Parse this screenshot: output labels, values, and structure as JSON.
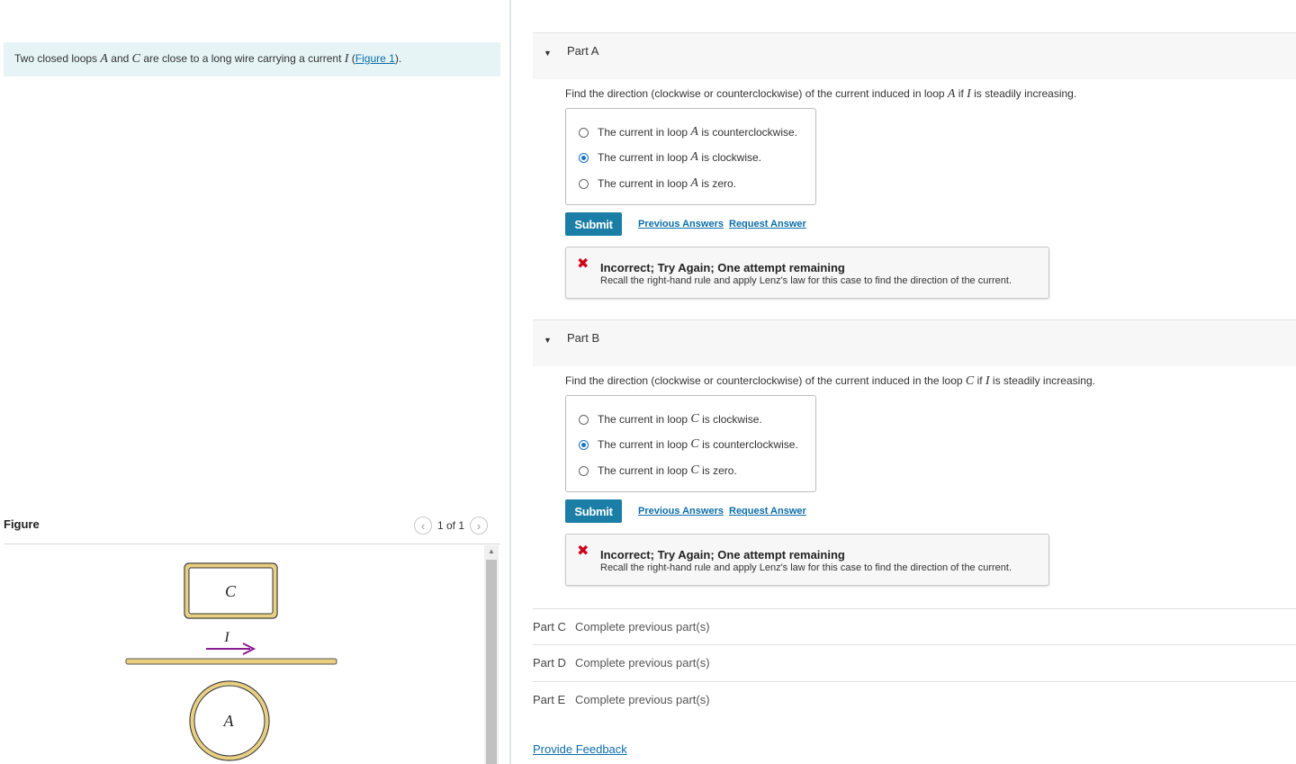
{
  "problem": {
    "text_before": "Two closed loops ",
    "var_a": "A",
    "and": " and ",
    "var_c": "C",
    "text_mid": " are close to a long wire carrying a current ",
    "var_i": "I",
    "paren_open": " (",
    "figure_link": "Figure 1",
    "paren_close": ")."
  },
  "figure": {
    "label": "Figure",
    "pager_text": "1 of 1",
    "loop_c_label": "C",
    "loop_a_label": "A",
    "current_label": "I",
    "colors": {
      "loop": "#e9cf80",
      "arrow": "#8b1a91"
    }
  },
  "parts": {
    "a": {
      "title": "Part A",
      "q_before": "Find the direction (clockwise or counterclockwise) of the current induced in loop ",
      "q_var": "A",
      "q_mid": " if ",
      "q_var2": "I",
      "q_after": " is steadily increasing.",
      "choices": [
        {
          "pre": "The current in loop ",
          "var": "A",
          "post": " is counterclockwise.",
          "selected": false
        },
        {
          "pre": "The current in loop ",
          "var": "A",
          "post": " is clockwise.",
          "selected": true
        },
        {
          "pre": "The current in loop ",
          "var": "A",
          "post": " is zero.",
          "selected": false
        }
      ],
      "submit": "Submit",
      "prev_answers": "Previous Answers",
      "request_answer": "Request Answer",
      "feedback_title": "Incorrect; Try Again; One attempt remaining",
      "feedback_msg": "Recall the right-hand rule and apply Lenz's law for this case to find the direction of the current."
    },
    "b": {
      "title": "Part B",
      "q_before": "Find the direction (clockwise or counterclockwise) of the current induced in the loop ",
      "q_var": "C",
      "q_mid": " if ",
      "q_var2": "I",
      "q_after": " is steadily increasing.",
      "choices": [
        {
          "pre": "The current in loop ",
          "var": "C",
          "post": " is clockwise.",
          "selected": false
        },
        {
          "pre": "The current in loop ",
          "var": "C",
          "post": " is counterclockwise.",
          "selected": true
        },
        {
          "pre": "The current in loop ",
          "var": "C",
          "post": " is zero.",
          "selected": false
        }
      ],
      "submit": "Submit",
      "prev_answers": "Previous Answers",
      "request_answer": "Request Answer",
      "feedback_title": "Incorrect; Try Again; One attempt remaining",
      "feedback_msg": "Recall the right-hand rule and apply Lenz's law for this case to find the direction of the current."
    },
    "locked": [
      {
        "name": "Part C",
        "status": "Complete previous part(s)"
      },
      {
        "name": "Part D",
        "status": "Complete previous part(s)"
      },
      {
        "name": "Part E",
        "status": "Complete previous part(s)"
      }
    ]
  },
  "footer": {
    "provide_feedback": "Provide Feedback"
  },
  "colors": {
    "accent": "#1a7ea6",
    "link": "#0b6ea8",
    "error": "#d0021b",
    "problem_bg": "#e6f4f6"
  }
}
